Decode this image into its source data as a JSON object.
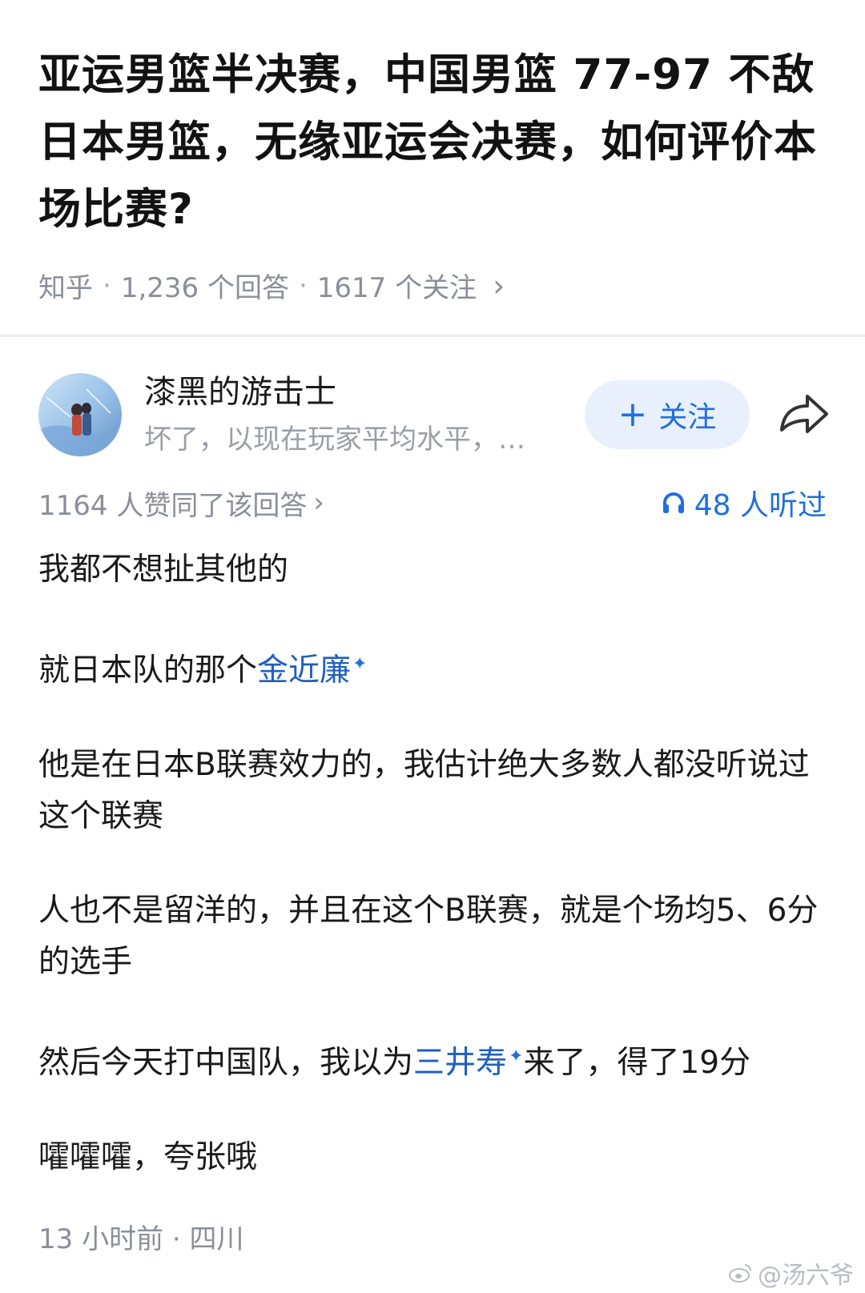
{
  "question": {
    "title": "亚运男篮半决赛，中国男篮 77-97 不敌日本男篮，无缘亚运会决赛，如何评价本场比赛?",
    "source": "知乎",
    "answers_count": "1,236 个回答",
    "followers_count": "1617 个关注",
    "separator": "·",
    "chevron": "›"
  },
  "author": {
    "name": "漆黑的游击士",
    "bio": "坏了，以现在玩家平均水平，…",
    "follow_label": "关注",
    "plus": "+"
  },
  "stats": {
    "votes": "1164 人赞同了该回答",
    "chevron": "›",
    "listened": "48 人听过"
  },
  "answer": {
    "p1": "我都不想扯其他的",
    "p2_prefix": "就日本队的那个",
    "p2_link": "金近廉",
    "p3": "他是在日本B联赛效力的，我估计绝大多数人都没听说过这个联赛",
    "p4": "人也不是留洋的，并且在这个B联赛，就是个场均5、6分的选手",
    "p5_prefix": "然后今天打中国队，我以为",
    "p5_link": "三井寿",
    "p5_suffix": "来了，得了19分",
    "p6": "嚯嚯嚯，夸张哦",
    "spark": "✦"
  },
  "footer": {
    "meta": "13 小时前 · 四川"
  },
  "watermark": {
    "text": "@汤六爷"
  },
  "colors": {
    "accent": "#1f6fe0",
    "link": "#1f5fbf",
    "muted": "#8a8f99",
    "follow_bg": "#e8f0fd"
  }
}
